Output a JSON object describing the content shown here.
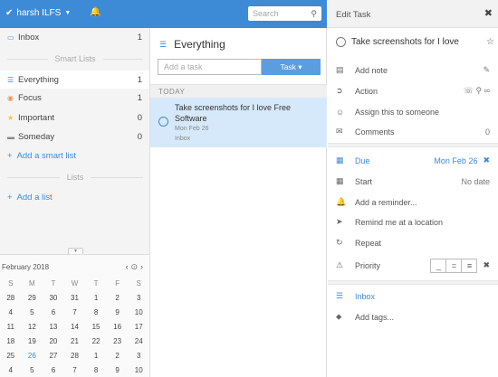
{
  "topbar": {
    "user_name": "harsh ILFS",
    "search_placeholder": "Search"
  },
  "sidebar": {
    "inbox": {
      "label": "Inbox",
      "count": "1"
    },
    "smart_lists_header": "Smart Lists",
    "items": [
      {
        "label": "Everything",
        "count": "1",
        "icon": "everything-icon",
        "color": "#3d8bd7"
      },
      {
        "label": "Focus",
        "count": "1",
        "icon": "focus-icon",
        "color": "#e8984a"
      },
      {
        "label": "Important",
        "count": "0",
        "icon": "important-icon",
        "color": "#f4c64a"
      },
      {
        "label": "Someday",
        "count": "0",
        "icon": "someday-icon",
        "color": "#888888"
      }
    ],
    "add_smart_list": "Add a smart list",
    "lists_header": "Lists",
    "add_list": "Add a list"
  },
  "calendar": {
    "month": "February 2018",
    "days_of_week": [
      "S",
      "M",
      "T",
      "W",
      "T",
      "F",
      "S"
    ],
    "weeks": [
      [
        "28",
        "29",
        "30",
        "31",
        "1",
        "2",
        "3"
      ],
      [
        "4",
        "5",
        "6",
        "7",
        "8",
        "9",
        "10"
      ],
      [
        "11",
        "12",
        "13",
        "14",
        "15",
        "16",
        "17"
      ],
      [
        "18",
        "19",
        "20",
        "21",
        "22",
        "23",
        "24"
      ],
      [
        "25",
        "26",
        "27",
        "28",
        "1",
        "2",
        "3"
      ],
      [
        "4",
        "5",
        "6",
        "7",
        "8",
        "9",
        "10"
      ]
    ],
    "today": "26"
  },
  "main": {
    "title": "Everything",
    "add_task_placeholder": "Add a task",
    "task_button": "Task",
    "section": "TODAY",
    "task": {
      "title": "Take screenshots for I love Free Software",
      "date": "Mon Feb 26",
      "list": "Inbox"
    }
  },
  "detail": {
    "header": "Edit Task",
    "task_title": "Take screenshots for I love",
    "add_note": "Add note",
    "action": "Action",
    "assign": "Assign this to someone",
    "comments": "Comments",
    "comments_count": "0",
    "due_label": "Due",
    "due_value": "Mon Feb 26",
    "start_label": "Start",
    "start_value": "No date",
    "reminder": "Add a reminder...",
    "location": "Remind me at a location",
    "repeat": "Repeat",
    "priority": "Priority",
    "list": "Inbox",
    "tags": "Add tags..."
  }
}
